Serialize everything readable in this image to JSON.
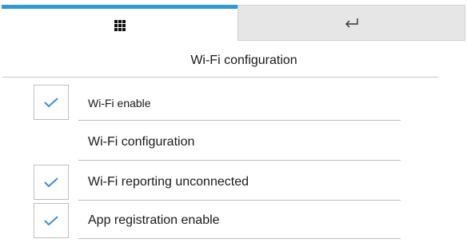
{
  "tabs": {
    "home_icon": "grid-menu-icon",
    "back_icon": "return-arrow-icon",
    "active_color": "#2f9ad8",
    "inactive_bg": "#e6e6e6"
  },
  "header": {
    "title": "Wi-Fi configuration"
  },
  "settings": {
    "items": [
      {
        "label": "Wi-Fi enable",
        "checked": true
      },
      {
        "label": "Wi-Fi configuration",
        "checked": null
      },
      {
        "label": "Wi-Fi reporting unconnected",
        "checked": true
      },
      {
        "label": "App registration enable",
        "checked": true
      }
    ]
  },
  "colors": {
    "check_mark": "#3d8fd1",
    "divider": "#bdbdbd"
  }
}
